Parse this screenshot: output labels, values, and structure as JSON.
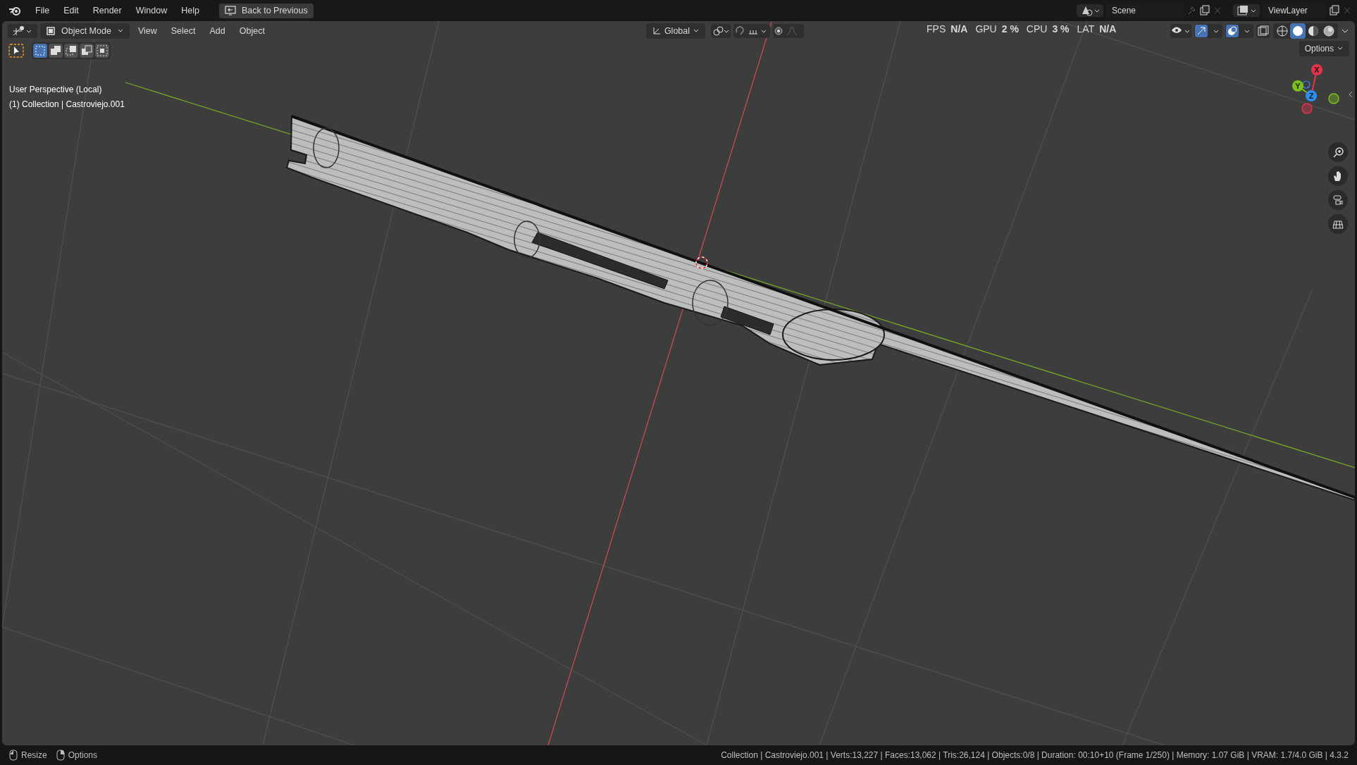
{
  "topbar": {
    "menus": [
      "File",
      "Edit",
      "Render",
      "Window",
      "Help"
    ],
    "back_button": "Back to Previous",
    "scene": "Scene",
    "view_layer": "ViewLayer"
  },
  "header": {
    "mode": "Object Mode",
    "menus": [
      "View",
      "Select",
      "Add",
      "Object"
    ],
    "orientation": "Global",
    "stats": [
      {
        "label": "FPS",
        "value": "N/A"
      },
      {
        "label": "GPU",
        "value": "2 %"
      },
      {
        "label": "CPU",
        "value": "3 %"
      },
      {
        "label": "LAT",
        "value": "N/A"
      }
    ],
    "shading_modes": [
      {
        "kind": "wireframe",
        "selected": false
      },
      {
        "kind": "solid",
        "selected": true
      },
      {
        "kind": "material",
        "selected": false
      },
      {
        "kind": "rendered",
        "selected": false
      }
    ],
    "options": "Options"
  },
  "tool_settings": {
    "selection_modes": [
      {
        "kind": "new",
        "selected": true
      },
      {
        "kind": "extend",
        "selected": false
      },
      {
        "kind": "subtract",
        "selected": false
      },
      {
        "kind": "invert",
        "selected": false
      },
      {
        "kind": "intersect",
        "selected": false
      }
    ]
  },
  "viewport": {
    "view_name": "User Perspective (Local)",
    "object_info": "(1) Collection | Castroviejo.001",
    "gizmo": [
      {
        "label": "X",
        "color": "#e5334b"
      },
      {
        "label": "Y",
        "color": "#7cbf1e"
      },
      {
        "label": "Z",
        "color": "#2f8ef5"
      }
    ]
  },
  "status_bar": {
    "hints": [
      {
        "kind": "resize",
        "label": "Resize"
      },
      {
        "kind": "options",
        "label": "Options"
      }
    ],
    "info": "Collection | Castroviejo.001 | Verts:13,227 | Faces:13,062 | Tris:26,124 | Objects:0/8 | Duration: 00:10+10 (Frame 1/250) | Memory: 1.07 GiB | VRAM: 1.7/4.0 GiB | 4.3.2"
  }
}
